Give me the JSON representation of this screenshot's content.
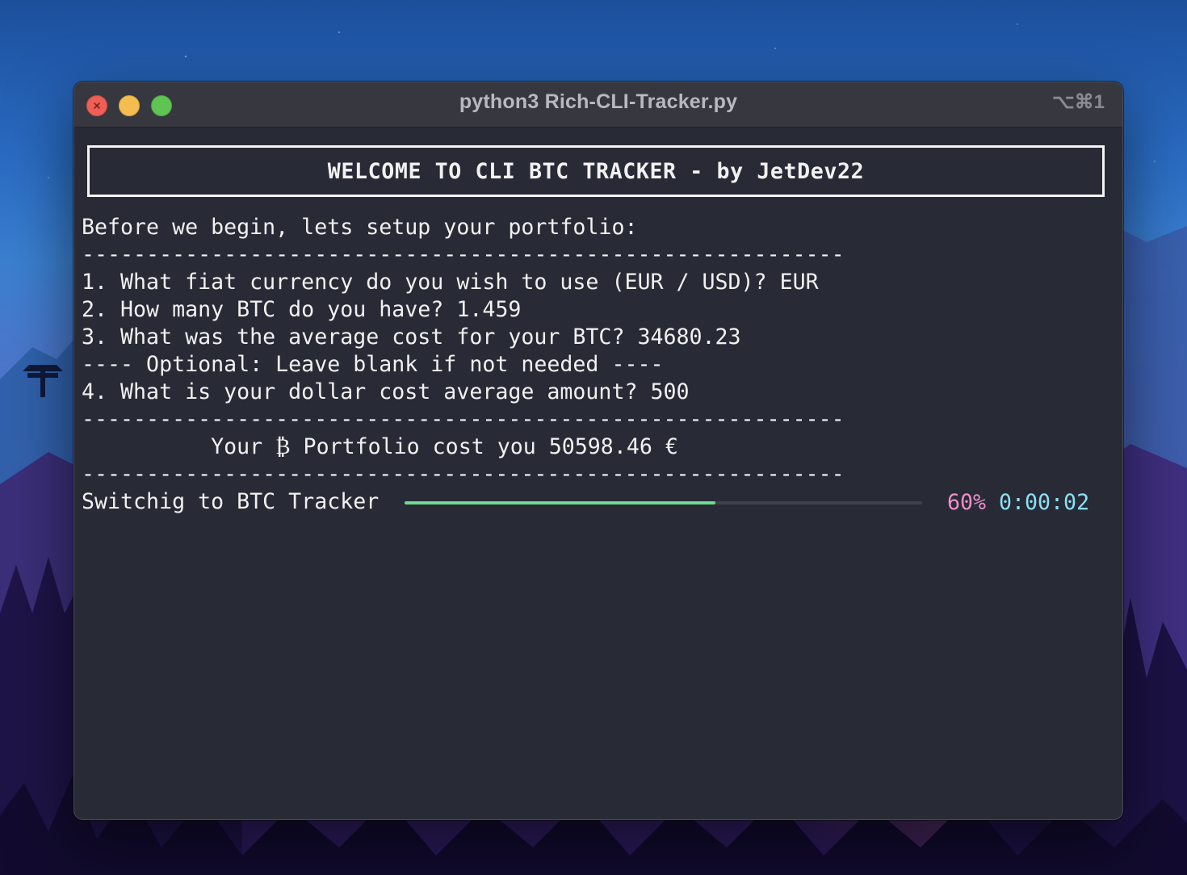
{
  "window": {
    "title": "python3 Rich-CLI-Tracker.py",
    "shortcut": "⌥⌘1"
  },
  "terminal": {
    "banner": "WELCOME TO CLI BTC TRACKER - by JetDev22",
    "intro": "Before we begin, lets setup your portfolio:",
    "separator": "-----------------------------------------------------------",
    "q1": "1. What fiat currency do you wish to use (EUR / USD)? EUR",
    "q2": "2. How many BTC do you have? 1.459",
    "q3": "3. What was the average cost for your BTC? 34680.23",
    "optional": "---- Optional: Leave blank if not needed ----",
    "q4": "4. What is your dollar cost average amount? 500",
    "portfolio_cost": "          Your ₿ Portfolio cost you 50598.46 €",
    "progress_label": "Switchig to BTC Tracker",
    "progress_value": 0.6,
    "progress_percent": "60%",
    "progress_eta": "0:00:02"
  },
  "colors": {
    "terminal_bg": "#282a36",
    "progress_fill": "#6edb8f",
    "percent_text": "#ec8fc8",
    "eta_text": "#8be0f5"
  }
}
